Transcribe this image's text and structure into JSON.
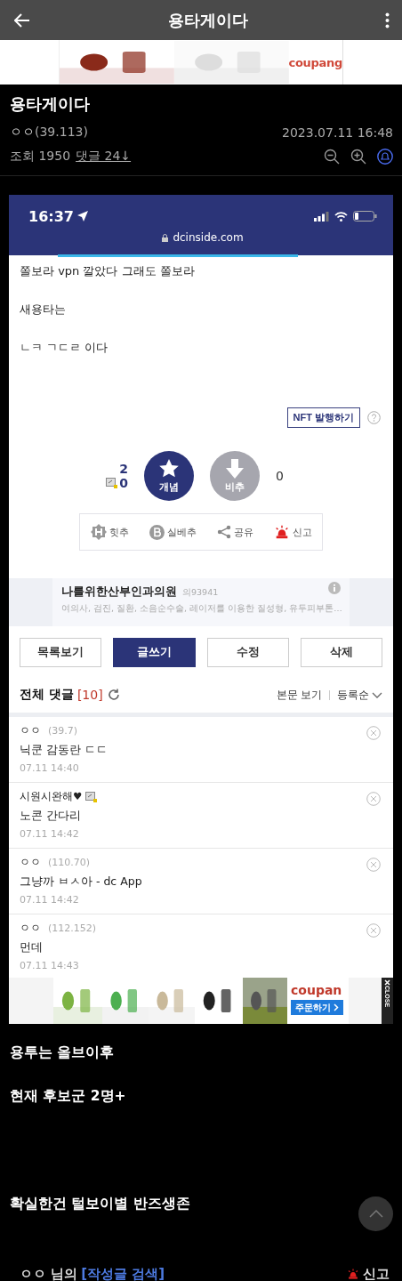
{
  "app_bar": {
    "title": "용타게이다"
  },
  "top_ad": {
    "kind": "picture",
    "logo": "coupang"
  },
  "post": {
    "title": "용타게이다",
    "author": "ㅇㅇ",
    "ip": "(39.113)",
    "date": "2023.07.11 16:48",
    "views": "조회 1950",
    "comments_link": "댓글 24↓"
  },
  "capture": {
    "time": "16:37",
    "url": "dcinside.com",
    "lines": [
      "쫄보라 vpn 깔았다 그래도 쫄보라",
      "새용타는",
      "ㄴㅋ ㄱㄷㄹ 이다"
    ],
    "nft_button": "NFT 발행하기",
    "votes": {
      "up_count": "2",
      "fixed_count": "0",
      "up_label": "개념",
      "down_label": "비추",
      "down_count": "0"
    },
    "actions": [
      {
        "kind": "hit",
        "label": "힛추"
      },
      {
        "kind": "best",
        "label": "실베추"
      },
      {
        "kind": "share",
        "label": "공유"
      },
      {
        "kind": "report",
        "label": "신고"
      }
    ],
    "ad": {
      "title": "나를위한산부인과의원",
      "code": "의93941",
      "text": "여의사, 검진, 질환, 소음순수술, 레이저를 이용한 질성형, 유두피부톤…"
    },
    "buttons": [
      {
        "label": "목록보기",
        "selected": false
      },
      {
        "label": "글쓰기",
        "selected": true
      },
      {
        "label": "수정",
        "selected": false
      },
      {
        "label": "삭제",
        "selected": false
      }
    ],
    "comments_header": {
      "title": "전체 댓글",
      "count": "[10]",
      "view_post": "본문 보기",
      "sort": "등록순"
    },
    "comments": [
      {
        "name": "ㅇㅇ",
        "ip": "(39.7)",
        "badge": false,
        "text": "닉쿤 감동란 ㄷㄷ",
        "time": "07.11 14:40"
      },
      {
        "name": "시원시완해♥",
        "badge": true,
        "text": "노콘 간다리",
        "time": "07.11 14:42"
      },
      {
        "name": "ㅇㅇ",
        "ip": "(110.70)",
        "badge": false,
        "text": "그냥까 ㅂㅅ아 - dc App",
        "time": "07.11 14:42"
      },
      {
        "name": "ㅇㅇ",
        "ip": "(112.152)",
        "badge": false,
        "text": "먼데",
        "time": "07.11 14:43"
      }
    ],
    "bottom_ad": {
      "logo": "coupan",
      "button": "주문하기",
      "close": "CLOSE"
    }
  },
  "body": [
    "용투는 올브이후",
    "현재 후보군 2명+",
    "확실한건 털보이별 반즈생존"
  ],
  "footer": {
    "author": "ㅇㅇ 님의",
    "search_link": "[작성글 검색]",
    "report": "신고"
  }
}
